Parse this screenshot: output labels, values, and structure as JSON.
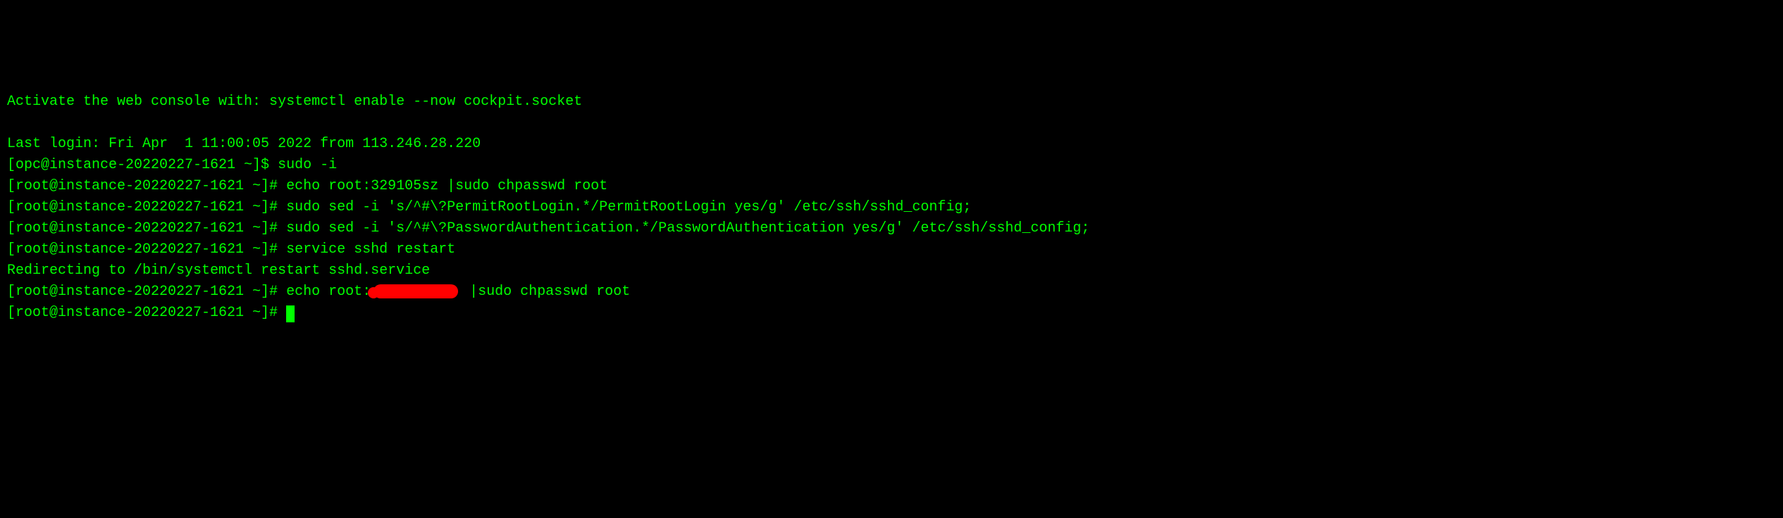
{
  "lines": {
    "l1": "Activate the web console with: systemctl enable --now cockpit.socket",
    "l2": "",
    "l3": "Last login: Fri Apr  1 11:00:05 2022 from 113.246.28.220",
    "l4_prompt": "[opc@instance-20220227-1621 ~]$ ",
    "l4_cmd": "sudo -i",
    "l5_prompt": "[root@instance-20220227-1621 ~]# ",
    "l5_cmd": "echo root:329105sz |sudo chpasswd root",
    "l6_prompt": "[root@instance-20220227-1621 ~]# ",
    "l6_cmd": "sudo sed -i 's/^#\\?PermitRootLogin.*/PermitRootLogin yes/g' /etc/ssh/sshd_config;",
    "l7_prompt": "[root@instance-20220227-1621 ~]# ",
    "l7_cmd": "sudo sed -i 's/^#\\?PasswordAuthentication.*/PasswordAuthentication yes/g' /etc/ssh/sshd_config;",
    "l8_prompt": "[root@instance-20220227-1621 ~]# ",
    "l8_cmd": "service sshd restart",
    "l9": "Redirecting to /bin/systemctl restart sshd.service",
    "l10_prompt": "[root@instance-20220227-1621 ~]# ",
    "l10_cmd_before": "echo root:",
    "l10_cmd_after": " |sudo chpasswd root",
    "l11_prompt": "[root@instance-20220227-1621 ~]# "
  }
}
